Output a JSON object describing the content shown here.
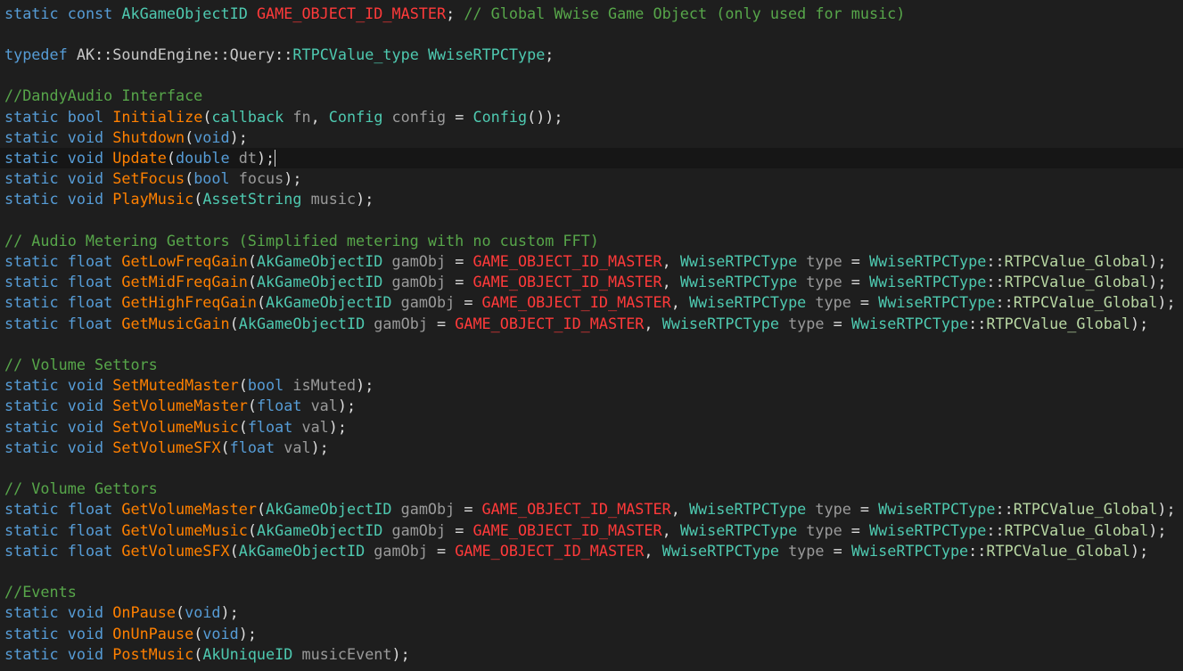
{
  "editor": {
    "colors": {
      "background": "#1e1e1e",
      "current_line": "#161616",
      "keyword": "#569cd6",
      "type": "#4ec9b0",
      "function": "#ff8000",
      "macro": "#ff3a3a",
      "comment": "#57a64a",
      "parameter": "#9a9a9a",
      "plain": "#dcdcdc",
      "enum_member": "#b8d7a3"
    },
    "current_line_index": 7,
    "lines": [
      {
        "tokens": [
          [
            "k",
            "static"
          ],
          [
            "o",
            " "
          ],
          [
            "k",
            "const"
          ],
          [
            "o",
            " "
          ],
          [
            "t",
            "AkGameObjectID"
          ],
          [
            "o",
            " "
          ],
          [
            "m",
            "GAME_OBJECT_ID_MASTER"
          ],
          [
            "o",
            "; "
          ],
          [
            "c",
            "// Global Wwise Game Object (only used for music)"
          ]
        ]
      },
      {
        "tokens": []
      },
      {
        "tokens": [
          [
            "k",
            "typedef"
          ],
          [
            "o",
            " "
          ],
          [
            "ns",
            "AK"
          ],
          [
            "o",
            "::"
          ],
          [
            "ns",
            "SoundEngine"
          ],
          [
            "o",
            "::"
          ],
          [
            "ns",
            "Query"
          ],
          [
            "o",
            "::"
          ],
          [
            "t",
            "RTPCValue_type"
          ],
          [
            "o",
            " "
          ],
          [
            "t",
            "WwiseRTPCType"
          ],
          [
            "o",
            ";"
          ]
        ]
      },
      {
        "tokens": []
      },
      {
        "tokens": [
          [
            "c",
            "//DandyAudio Interface"
          ]
        ]
      },
      {
        "tokens": [
          [
            "k",
            "static"
          ],
          [
            "o",
            " "
          ],
          [
            "k",
            "bool"
          ],
          [
            "o",
            " "
          ],
          [
            "f",
            "Initialize"
          ],
          [
            "o",
            "("
          ],
          [
            "t",
            "callback"
          ],
          [
            "o",
            " "
          ],
          [
            "p",
            "fn"
          ],
          [
            "o",
            ", "
          ],
          [
            "t",
            "Config"
          ],
          [
            "o",
            " "
          ],
          [
            "p",
            "config"
          ],
          [
            "o",
            " = "
          ],
          [
            "t",
            "Config"
          ],
          [
            "o",
            "());"
          ]
        ]
      },
      {
        "tokens": [
          [
            "k",
            "static"
          ],
          [
            "o",
            " "
          ],
          [
            "k",
            "void"
          ],
          [
            "o",
            " "
          ],
          [
            "f",
            "Shutdown"
          ],
          [
            "o",
            "("
          ],
          [
            "k",
            "void"
          ],
          [
            "o",
            ");"
          ]
        ]
      },
      {
        "tokens": [
          [
            "k",
            "static"
          ],
          [
            "o",
            " "
          ],
          [
            "k",
            "void"
          ],
          [
            "o",
            " "
          ],
          [
            "f",
            "Update"
          ],
          [
            "o",
            "("
          ],
          [
            "k",
            "double"
          ],
          [
            "o",
            " "
          ],
          [
            "p",
            "dt"
          ],
          [
            "o",
            ");"
          ]
        ]
      },
      {
        "tokens": [
          [
            "k",
            "static"
          ],
          [
            "o",
            " "
          ],
          [
            "k",
            "void"
          ],
          [
            "o",
            " "
          ],
          [
            "f",
            "SetFocus"
          ],
          [
            "o",
            "("
          ],
          [
            "k",
            "bool"
          ],
          [
            "o",
            " "
          ],
          [
            "p",
            "focus"
          ],
          [
            "o",
            ");"
          ]
        ]
      },
      {
        "tokens": [
          [
            "k",
            "static"
          ],
          [
            "o",
            " "
          ],
          [
            "k",
            "void"
          ],
          [
            "o",
            " "
          ],
          [
            "f",
            "PlayMusic"
          ],
          [
            "o",
            "("
          ],
          [
            "t",
            "AssetString"
          ],
          [
            "o",
            " "
          ],
          [
            "p",
            "music"
          ],
          [
            "o",
            ");"
          ]
        ]
      },
      {
        "tokens": []
      },
      {
        "tokens": [
          [
            "c",
            "// Audio Metering Gettors (Simplified metering with no custom FFT)"
          ]
        ]
      },
      {
        "tokens": [
          [
            "k",
            "static"
          ],
          [
            "o",
            " "
          ],
          [
            "k",
            "float"
          ],
          [
            "o",
            " "
          ],
          [
            "f",
            "GetLowFreqGain"
          ],
          [
            "o",
            "("
          ],
          [
            "t",
            "AkGameObjectID"
          ],
          [
            "o",
            " "
          ],
          [
            "p",
            "gamObj"
          ],
          [
            "o",
            " = "
          ],
          [
            "m",
            "GAME_OBJECT_ID_MASTER"
          ],
          [
            "o",
            ", "
          ],
          [
            "t",
            "WwiseRTPCType"
          ],
          [
            "o",
            " "
          ],
          [
            "p",
            "type"
          ],
          [
            "o",
            " = "
          ],
          [
            "t",
            "WwiseRTPCType"
          ],
          [
            "o",
            "::"
          ],
          [
            "e",
            "RTPCValue_Global"
          ],
          [
            "o",
            ");"
          ]
        ]
      },
      {
        "tokens": [
          [
            "k",
            "static"
          ],
          [
            "o",
            " "
          ],
          [
            "k",
            "float"
          ],
          [
            "o",
            " "
          ],
          [
            "f",
            "GetMidFreqGain"
          ],
          [
            "o",
            "("
          ],
          [
            "t",
            "AkGameObjectID"
          ],
          [
            "o",
            " "
          ],
          [
            "p",
            "gamObj"
          ],
          [
            "o",
            " = "
          ],
          [
            "m",
            "GAME_OBJECT_ID_MASTER"
          ],
          [
            "o",
            ", "
          ],
          [
            "t",
            "WwiseRTPCType"
          ],
          [
            "o",
            " "
          ],
          [
            "p",
            "type"
          ],
          [
            "o",
            " = "
          ],
          [
            "t",
            "WwiseRTPCType"
          ],
          [
            "o",
            "::"
          ],
          [
            "e",
            "RTPCValue_Global"
          ],
          [
            "o",
            ");"
          ]
        ]
      },
      {
        "tokens": [
          [
            "k",
            "static"
          ],
          [
            "o",
            " "
          ],
          [
            "k",
            "float"
          ],
          [
            "o",
            " "
          ],
          [
            "f",
            "GetHighFreqGain"
          ],
          [
            "o",
            "("
          ],
          [
            "t",
            "AkGameObjectID"
          ],
          [
            "o",
            " "
          ],
          [
            "p",
            "gamObj"
          ],
          [
            "o",
            " = "
          ],
          [
            "m",
            "GAME_OBJECT_ID_MASTER"
          ],
          [
            "o",
            ", "
          ],
          [
            "t",
            "WwiseRTPCType"
          ],
          [
            "o",
            " "
          ],
          [
            "p",
            "type"
          ],
          [
            "o",
            " = "
          ],
          [
            "t",
            "WwiseRTPCType"
          ],
          [
            "o",
            "::"
          ],
          [
            "e",
            "RTPCValue_Global"
          ],
          [
            "o",
            ");"
          ]
        ]
      },
      {
        "tokens": [
          [
            "k",
            "static"
          ],
          [
            "o",
            " "
          ],
          [
            "k",
            "float"
          ],
          [
            "o",
            " "
          ],
          [
            "f",
            "GetMusicGain"
          ],
          [
            "o",
            "("
          ],
          [
            "t",
            "AkGameObjectID"
          ],
          [
            "o",
            " "
          ],
          [
            "p",
            "gamObj"
          ],
          [
            "o",
            " = "
          ],
          [
            "m",
            "GAME_OBJECT_ID_MASTER"
          ],
          [
            "o",
            ", "
          ],
          [
            "t",
            "WwiseRTPCType"
          ],
          [
            "o",
            " "
          ],
          [
            "p",
            "type"
          ],
          [
            "o",
            " = "
          ],
          [
            "t",
            "WwiseRTPCType"
          ],
          [
            "o",
            "::"
          ],
          [
            "e",
            "RTPCValue_Global"
          ],
          [
            "o",
            ");"
          ]
        ]
      },
      {
        "tokens": []
      },
      {
        "tokens": [
          [
            "c",
            "// Volume Settors"
          ]
        ]
      },
      {
        "tokens": [
          [
            "k",
            "static"
          ],
          [
            "o",
            " "
          ],
          [
            "k",
            "void"
          ],
          [
            "o",
            " "
          ],
          [
            "f",
            "SetMutedMaster"
          ],
          [
            "o",
            "("
          ],
          [
            "k",
            "bool"
          ],
          [
            "o",
            " "
          ],
          [
            "p",
            "isMuted"
          ],
          [
            "o",
            ");"
          ]
        ]
      },
      {
        "tokens": [
          [
            "k",
            "static"
          ],
          [
            "o",
            " "
          ],
          [
            "k",
            "void"
          ],
          [
            "o",
            " "
          ],
          [
            "f",
            "SetVolumeMaster"
          ],
          [
            "o",
            "("
          ],
          [
            "k",
            "float"
          ],
          [
            "o",
            " "
          ],
          [
            "p",
            "val"
          ],
          [
            "o",
            ");"
          ]
        ]
      },
      {
        "tokens": [
          [
            "k",
            "static"
          ],
          [
            "o",
            " "
          ],
          [
            "k",
            "void"
          ],
          [
            "o",
            " "
          ],
          [
            "f",
            "SetVolumeMusic"
          ],
          [
            "o",
            "("
          ],
          [
            "k",
            "float"
          ],
          [
            "o",
            " "
          ],
          [
            "p",
            "val"
          ],
          [
            "o",
            ");"
          ]
        ]
      },
      {
        "tokens": [
          [
            "k",
            "static"
          ],
          [
            "o",
            " "
          ],
          [
            "k",
            "void"
          ],
          [
            "o",
            " "
          ],
          [
            "f",
            "SetVolumeSFX"
          ],
          [
            "o",
            "("
          ],
          [
            "k",
            "float"
          ],
          [
            "o",
            " "
          ],
          [
            "p",
            "val"
          ],
          [
            "o",
            ");"
          ]
        ]
      },
      {
        "tokens": []
      },
      {
        "tokens": [
          [
            "c",
            "// Volume Gettors"
          ]
        ]
      },
      {
        "tokens": [
          [
            "k",
            "static"
          ],
          [
            "o",
            " "
          ],
          [
            "k",
            "float"
          ],
          [
            "o",
            " "
          ],
          [
            "f",
            "GetVolumeMaster"
          ],
          [
            "o",
            "("
          ],
          [
            "t",
            "AkGameObjectID"
          ],
          [
            "o",
            " "
          ],
          [
            "p",
            "gamObj"
          ],
          [
            "o",
            " = "
          ],
          [
            "m",
            "GAME_OBJECT_ID_MASTER"
          ],
          [
            "o",
            ", "
          ],
          [
            "t",
            "WwiseRTPCType"
          ],
          [
            "o",
            " "
          ],
          [
            "p",
            "type"
          ],
          [
            "o",
            " = "
          ],
          [
            "t",
            "WwiseRTPCType"
          ],
          [
            "o",
            "::"
          ],
          [
            "e",
            "RTPCValue_Global"
          ],
          [
            "o",
            ");"
          ]
        ]
      },
      {
        "tokens": [
          [
            "k",
            "static"
          ],
          [
            "o",
            " "
          ],
          [
            "k",
            "float"
          ],
          [
            "o",
            " "
          ],
          [
            "f",
            "GetVolumeMusic"
          ],
          [
            "o",
            "("
          ],
          [
            "t",
            "AkGameObjectID"
          ],
          [
            "o",
            " "
          ],
          [
            "p",
            "gamObj"
          ],
          [
            "o",
            " = "
          ],
          [
            "m",
            "GAME_OBJECT_ID_MASTER"
          ],
          [
            "o",
            ", "
          ],
          [
            "t",
            "WwiseRTPCType"
          ],
          [
            "o",
            " "
          ],
          [
            "p",
            "type"
          ],
          [
            "o",
            " = "
          ],
          [
            "t",
            "WwiseRTPCType"
          ],
          [
            "o",
            "::"
          ],
          [
            "e",
            "RTPCValue_Global"
          ],
          [
            "o",
            ");"
          ]
        ]
      },
      {
        "tokens": [
          [
            "k",
            "static"
          ],
          [
            "o",
            " "
          ],
          [
            "k",
            "float"
          ],
          [
            "o",
            " "
          ],
          [
            "f",
            "GetVolumeSFX"
          ],
          [
            "o",
            "("
          ],
          [
            "t",
            "AkGameObjectID"
          ],
          [
            "o",
            " "
          ],
          [
            "p",
            "gamObj"
          ],
          [
            "o",
            " = "
          ],
          [
            "m",
            "GAME_OBJECT_ID_MASTER"
          ],
          [
            "o",
            ", "
          ],
          [
            "t",
            "WwiseRTPCType"
          ],
          [
            "o",
            " "
          ],
          [
            "p",
            "type"
          ],
          [
            "o",
            " = "
          ],
          [
            "t",
            "WwiseRTPCType"
          ],
          [
            "o",
            "::"
          ],
          [
            "e",
            "RTPCValue_Global"
          ],
          [
            "o",
            ");"
          ]
        ]
      },
      {
        "tokens": []
      },
      {
        "tokens": [
          [
            "c",
            "//Events"
          ]
        ]
      },
      {
        "tokens": [
          [
            "k",
            "static"
          ],
          [
            "o",
            " "
          ],
          [
            "k",
            "void"
          ],
          [
            "o",
            " "
          ],
          [
            "f",
            "OnPause"
          ],
          [
            "o",
            "("
          ],
          [
            "k",
            "void"
          ],
          [
            "o",
            ");"
          ]
        ]
      },
      {
        "tokens": [
          [
            "k",
            "static"
          ],
          [
            "o",
            " "
          ],
          [
            "k",
            "void"
          ],
          [
            "o",
            " "
          ],
          [
            "f",
            "OnUnPause"
          ],
          [
            "o",
            "("
          ],
          [
            "k",
            "void"
          ],
          [
            "o",
            ");"
          ]
        ]
      },
      {
        "tokens": [
          [
            "k",
            "static"
          ],
          [
            "o",
            " "
          ],
          [
            "k",
            "void"
          ],
          [
            "o",
            " "
          ],
          [
            "f",
            "PostMusic"
          ],
          [
            "o",
            "("
          ],
          [
            "t",
            "AkUniqueID"
          ],
          [
            "o",
            " "
          ],
          [
            "p",
            "musicEvent"
          ],
          [
            "o",
            ");"
          ]
        ]
      }
    ]
  }
}
